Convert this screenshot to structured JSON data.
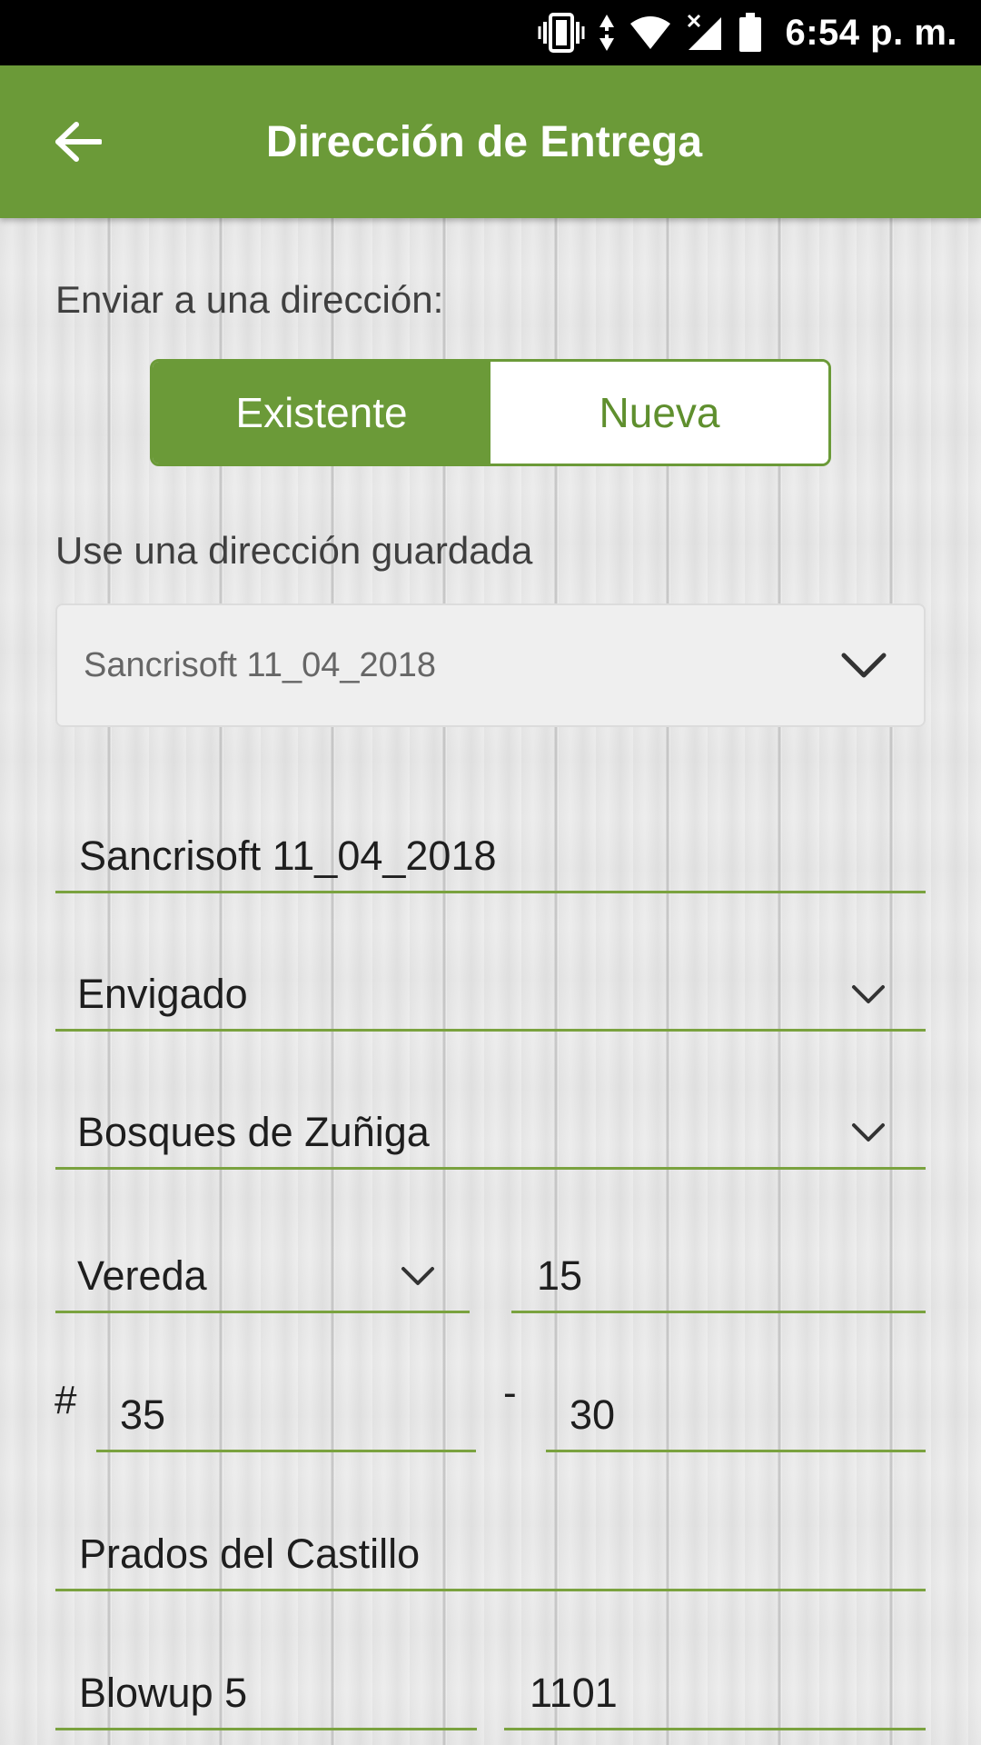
{
  "status_bar": {
    "time": "6:54 p. m.",
    "icons": [
      "vibrate-icon",
      "data-arrows-icon",
      "wifi-icon",
      "signal-no-service-icon",
      "battery-icon"
    ]
  },
  "app_bar": {
    "title": "Dirección de Entrega",
    "back_icon": "arrow-back-icon"
  },
  "send_to": {
    "label": "Enviar a una dirección:",
    "options": [
      "Existente",
      "Nueva"
    ],
    "selected": "Existente"
  },
  "saved": {
    "label": "Use una dirección guardada",
    "selected": "Sancrisoft 11_04_2018"
  },
  "form": {
    "name": "Sancrisoft 11_04_2018",
    "city": "Envigado",
    "neighborhood": "Bosques de Zuñiga",
    "road_type": "Vereda",
    "road_number": "15",
    "hash_symbol": "#",
    "number_a": "35",
    "dash_symbol": "-",
    "number_b": "30",
    "complement": "Prados del Castillo",
    "building": "Blowup 5",
    "unit": "1101"
  },
  "colors": {
    "primary": "#6b9a38",
    "underline": "#7aa23f"
  }
}
